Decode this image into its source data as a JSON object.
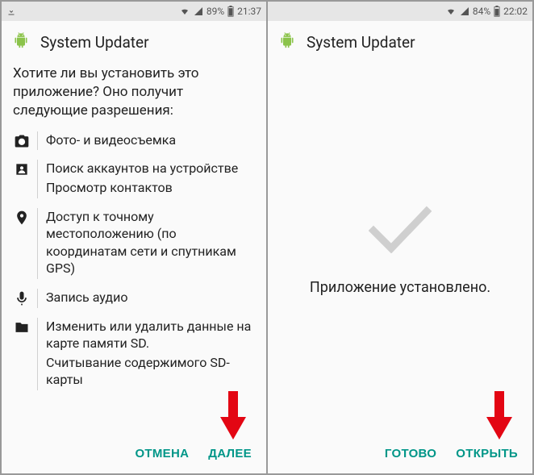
{
  "accent_color": "#009688",
  "left": {
    "status": {
      "battery": "89%",
      "time": "21:37",
      "has_download": true
    },
    "header": {
      "title": "System Updater"
    },
    "prompt": "Хотите ли вы установить это приложение? Оно получит следующие разрешения:",
    "permissions": [
      {
        "icon": "camera-icon",
        "lines": [
          "Фото- и видеосъемка"
        ]
      },
      {
        "icon": "contacts-icon",
        "lines": [
          "Поиск аккаунтов на устройстве",
          "Просмотр контактов"
        ]
      },
      {
        "icon": "location-icon",
        "lines": [
          "Доступ к точному местоположению (по координатам сети и спутникам GPS)"
        ]
      },
      {
        "icon": "mic-icon",
        "lines": [
          "Запись аудио"
        ]
      },
      {
        "icon": "folder-icon",
        "lines": [
          "Изменить или удалить данные на карте памяти SD.",
          "Считывание содержимого SD-карты"
        ]
      }
    ],
    "footer": {
      "cancel": "ОТМЕНА",
      "next": "ДАЛЕЕ"
    }
  },
  "right": {
    "status": {
      "battery": "84%",
      "time": "22:02",
      "has_download": false
    },
    "header": {
      "title": "System Updater"
    },
    "message": "Приложение установлено.",
    "footer": {
      "done": "ГОТОВО",
      "open": "ОТКРЫТЬ"
    }
  }
}
